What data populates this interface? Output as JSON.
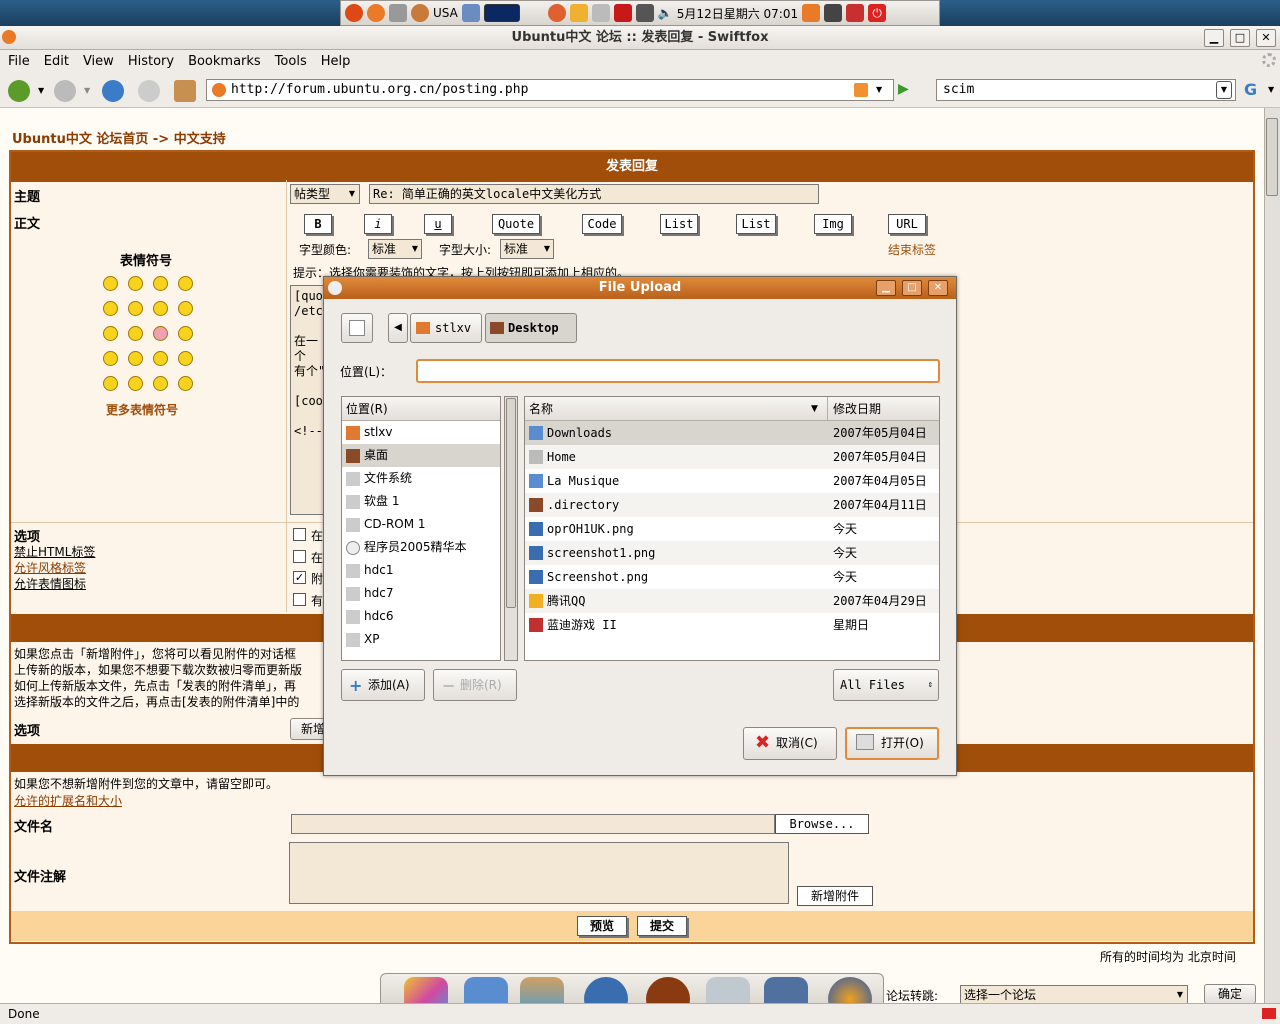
{
  "panel": {
    "keyboard": "USA",
    "clock": "5月12日星期六 07:01"
  },
  "window": {
    "title": "Ubuntu中文 论坛 :: 发表回复 - Swiftfox",
    "min": "▁",
    "max": "□",
    "close": "✕"
  },
  "menu": [
    "File",
    "Edit",
    "View",
    "History",
    "Bookmarks",
    "Tools",
    "Help"
  ],
  "toolbar": {
    "url": "http://forum.ubuntu.org.cn/posting.php",
    "search": "scim"
  },
  "breadcrumb": {
    "home": "Ubuntu中文 论坛首页",
    "arrow": "->",
    "section": "中文支持"
  },
  "form": {
    "header": "发表回复",
    "subject_label": "主题",
    "post_type": "帖类型",
    "subject_value": "Re: 简单正确的英文locale中文美化方式",
    "body_label": "正文",
    "smilies_title": "表情符号",
    "more_smilies": "更多表情符号",
    "format_buttons": [
      "B",
      "i",
      "u",
      "Quote",
      "Code",
      "List",
      "List",
      "Img",
      "URL"
    ],
    "font_color_label": "字型颜色:",
    "font_color_value": "标准",
    "font_size_label": "字型大小:",
    "font_size_value": "标准",
    "close_tags": "结束标签",
    "hint": "提示：选择你需要装饰的文字，按上列按钮即可添加上相应的。",
    "body_lines": [
      "[quo",
      "/etc",
      "",
      "在一个",
      "有个\"",
      "",
      "[coo",
      "",
      "<!--"
    ],
    "options_label": "选项",
    "html_disabled": "禁止HTML标签",
    "bbcode_enabled": "允许风格标签",
    "smilies_enabled": "允许表情图标",
    "option_checks": [
      "在",
      "在",
      "附",
      "有"
    ],
    "attach_help": [
      "如果您点击「新增附件」，您将可以看见附件的对话框",
      "上传新的版本，如果您不想要下载次数被归零而更新版",
      "如何上传新版本文件，先点击「发表的附件清单」，再",
      "选择新版本的文件之后，再点击[发表的附件清单]中的"
    ],
    "options_label2": "选项",
    "add_btn_partial": "新增",
    "attach_note": "如果您不想新增附件到您的文章中，请留空即可。",
    "allowed_ext": "允许的扩展名和大小",
    "filename_label": "文件名",
    "browse": "Browse...",
    "comment_label": "文件注解",
    "add_attachment": "新增附件",
    "preview": "预览",
    "submit": "提交",
    "timezone": "所有的时间均为 北京时间",
    "jump_label": "论坛转跳:",
    "jump_select": "选择一个论坛",
    "jump_go": "确定"
  },
  "dialog": {
    "title": "File Upload",
    "path": [
      "stlxv",
      "Desktop"
    ],
    "location_label": "位置(L)：",
    "location_value": "",
    "places_header": "位置(R)",
    "places": [
      "stlxv",
      "桌面",
      "文件系统",
      "软盘 1",
      "CD-ROM 1",
      "程序员2005精华本",
      "hdc1",
      "hdc7",
      "hdc6",
      "XP"
    ],
    "name_header": "名称",
    "date_header": "修改日期",
    "files": [
      {
        "name": "Downloads",
        "date": "2007年05月04日",
        "icon": "folder-icon"
      },
      {
        "name": "Home",
        "date": "2007年05月04日",
        "icon": "home-icon"
      },
      {
        "name": "La Musique",
        "date": "2007年04月05日",
        "icon": "folder-icon"
      },
      {
        "name": ".directory",
        "date": "2007年04月11日",
        "icon": "file-icon"
      },
      {
        "name": "oprOH1UK.png",
        "date": "今天",
        "icon": "image-icon"
      },
      {
        "name": "screenshot1.png",
        "date": "今天",
        "icon": "image-icon"
      },
      {
        "name": "Screenshot.png",
        "date": "今天",
        "icon": "image-icon"
      },
      {
        "name": "腾讯QQ",
        "date": "2007年04月29日",
        "icon": "qq-icon"
      },
      {
        "name": "蓝迪游戏 II",
        "date": "星期日",
        "icon": "game-icon"
      }
    ],
    "add": "添加(A)",
    "remove": "删除(R)",
    "filter": "All Files",
    "cancel": "取消(C)",
    "open": "打开(O)"
  },
  "status": "Done",
  "colors": {
    "accent": "#a04e0a",
    "link": "#8a3b00",
    "dialog_title": "#c8702a"
  }
}
